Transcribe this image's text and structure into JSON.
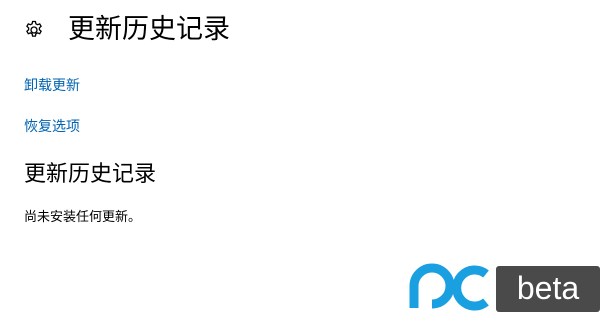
{
  "header": {
    "icon": "gear-icon",
    "title": "更新历史记录"
  },
  "links": {
    "uninstall_updates": "卸载更新",
    "recovery_options": "恢复选项"
  },
  "section": {
    "title": "更新历史记录",
    "status": "尚未安装任何更新。"
  },
  "watermark": {
    "brand_text": "beta",
    "brand_color": "#1aa0e0",
    "box_color": "#4a4a4a"
  },
  "colors": {
    "link": "#0063b1",
    "text": "#000000",
    "background": "#ffffff"
  }
}
